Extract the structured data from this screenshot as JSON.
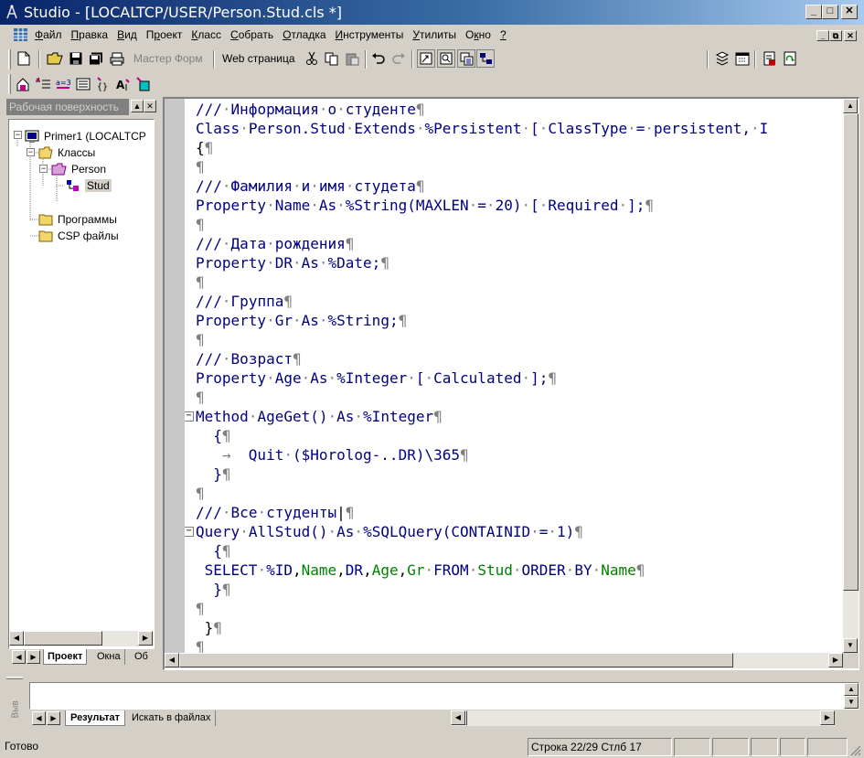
{
  "window": {
    "title": "Studio - [LOCALTCP/USER/Person.Stud.cls *]",
    "min_glyph": "_",
    "max_glyph": "□",
    "close_glyph": "✕"
  },
  "menu": {
    "items": [
      {
        "label": "Файл",
        "accel": "Ф",
        "rest": "айл"
      },
      {
        "label": "Правка",
        "accel": "П",
        "rest": "равка"
      },
      {
        "label": "Вид",
        "accel": "В",
        "rest": "ид"
      },
      {
        "label": "Проект",
        "accel": "р",
        "pre": "П",
        "rest": "оект"
      },
      {
        "label": "Класс",
        "accel": "К",
        "rest": "ласс"
      },
      {
        "label": "Собрать",
        "accel": "С",
        "rest": "обрать"
      },
      {
        "label": "Отладка",
        "accel": "О",
        "rest": "тладка"
      },
      {
        "label": "Инструменты",
        "accel": "И",
        "rest": "нструменты"
      },
      {
        "label": "Утилиты",
        "accel": "У",
        "rest": "тилиты"
      },
      {
        "label": "Окно",
        "accel": "к",
        "pre": "О",
        "rest": "но"
      },
      {
        "label": "?",
        "accel": "?",
        "rest": ""
      }
    ]
  },
  "toolbar": {
    "wizard_label": "Мастер Форм",
    "web_label": "Web страница",
    "combo_value": ""
  },
  "workspace": {
    "title": "Рабочая поверхность",
    "tree": {
      "root": "Primer1  (LOCALTCP",
      "classes": "Классы",
      "package": "Person",
      "class": "Stud",
      "programs": "Программы",
      "csp": "CSP файлы"
    },
    "tabs": [
      "Проект",
      "Окна",
      "Об"
    ]
  },
  "editor": {
    "lines": [
      [
        [
          "c",
          "///"
        ],
        [
          "p",
          "·"
        ],
        [
          "c",
          "Информация"
        ],
        [
          "p",
          "·"
        ],
        [
          "c",
          "о"
        ],
        [
          "p",
          "·"
        ],
        [
          "c",
          "студенте"
        ],
        [
          "p",
          "¶"
        ]
      ],
      [
        [
          "c",
          "Class"
        ],
        [
          "p",
          "·"
        ],
        [
          "c",
          "Person.Stud"
        ],
        [
          "p",
          "·"
        ],
        [
          "c",
          "Extends"
        ],
        [
          "p",
          "·"
        ],
        [
          "c",
          "%Persistent"
        ],
        [
          "p",
          "·"
        ],
        [
          "c",
          "["
        ],
        [
          "p",
          "·"
        ],
        [
          "c",
          "ClassType"
        ],
        [
          "p",
          "·"
        ],
        [
          "c",
          "="
        ],
        [
          "p",
          "·"
        ],
        [
          "c",
          "persistent,"
        ],
        [
          "p",
          "·"
        ],
        [
          "c",
          "I"
        ]
      ],
      [
        [
          "b",
          "{"
        ],
        [
          "p",
          "¶"
        ]
      ],
      [
        [
          "p",
          "¶"
        ]
      ],
      [
        [
          "c",
          "///"
        ],
        [
          "p",
          "·"
        ],
        [
          "c",
          "Фамилия"
        ],
        [
          "p",
          "·"
        ],
        [
          "c",
          "и"
        ],
        [
          "p",
          "·"
        ],
        [
          "c",
          "имя"
        ],
        [
          "p",
          "·"
        ],
        [
          "c",
          "студета"
        ],
        [
          "p",
          "¶"
        ]
      ],
      [
        [
          "c",
          "Property"
        ],
        [
          "p",
          "·"
        ],
        [
          "c",
          "Name"
        ],
        [
          "p",
          "·"
        ],
        [
          "c",
          "As"
        ],
        [
          "p",
          "·"
        ],
        [
          "c",
          "%String(MAXLEN"
        ],
        [
          "p",
          "·"
        ],
        [
          "c",
          "="
        ],
        [
          "p",
          "·"
        ],
        [
          "c",
          "20)"
        ],
        [
          "p",
          "·"
        ],
        [
          "c",
          "["
        ],
        [
          "p",
          "·"
        ],
        [
          "c",
          "Required"
        ],
        [
          "p",
          "·"
        ],
        [
          "c",
          "];"
        ],
        [
          "p",
          "¶"
        ]
      ],
      [
        [
          "p",
          "¶"
        ]
      ],
      [
        [
          "c",
          "///"
        ],
        [
          "p",
          "·"
        ],
        [
          "c",
          "Дата"
        ],
        [
          "p",
          "·"
        ],
        [
          "c",
          "рождения"
        ],
        [
          "p",
          "¶"
        ]
      ],
      [
        [
          "c",
          "Property"
        ],
        [
          "p",
          "·"
        ],
        [
          "c",
          "DR"
        ],
        [
          "p",
          "·"
        ],
        [
          "c",
          "As"
        ],
        [
          "p",
          "·"
        ],
        [
          "c",
          "%Date;"
        ],
        [
          "p",
          "¶"
        ]
      ],
      [
        [
          "p",
          "¶"
        ]
      ],
      [
        [
          "c",
          "///"
        ],
        [
          "p",
          "·"
        ],
        [
          "c",
          "Группа"
        ],
        [
          "p",
          "¶"
        ]
      ],
      [
        [
          "c",
          "Property"
        ],
        [
          "p",
          "·"
        ],
        [
          "c",
          "Gr"
        ],
        [
          "p",
          "·"
        ],
        [
          "c",
          "As"
        ],
        [
          "p",
          "·"
        ],
        [
          "c",
          "%String;"
        ],
        [
          "p",
          "¶"
        ]
      ],
      [
        [
          "p",
          "¶"
        ]
      ],
      [
        [
          "c",
          "///"
        ],
        [
          "p",
          "·"
        ],
        [
          "c",
          "Возраст"
        ],
        [
          "p",
          "¶"
        ]
      ],
      [
        [
          "c",
          "Property"
        ],
        [
          "p",
          "·"
        ],
        [
          "c",
          "Age"
        ],
        [
          "p",
          "·"
        ],
        [
          "c",
          "As"
        ],
        [
          "p",
          "·"
        ],
        [
          "c",
          "%Integer"
        ],
        [
          "p",
          "·"
        ],
        [
          "c",
          "["
        ],
        [
          "p",
          "·"
        ],
        [
          "c",
          "Calculated"
        ],
        [
          "p",
          "·"
        ],
        [
          "c",
          "];"
        ],
        [
          "p",
          "¶"
        ]
      ],
      [
        [
          "p",
          "¶"
        ]
      ],
      [
        [
          "c",
          "Method"
        ],
        [
          "p",
          "·"
        ],
        [
          "c",
          "AgeGet()"
        ],
        [
          "p",
          "·"
        ],
        [
          "c",
          "As"
        ],
        [
          "p",
          "·"
        ],
        [
          "c",
          "%Integer"
        ],
        [
          "p",
          "¶"
        ]
      ],
      [
        [
          "c",
          "  {"
        ],
        [
          "p",
          "¶"
        ]
      ],
      [
        [
          "p",
          "   →  "
        ],
        [
          "c",
          "Quit"
        ],
        [
          "p",
          "·"
        ],
        [
          "c",
          "($Horolog-..DR)\\365"
        ],
        [
          "p",
          "¶"
        ]
      ],
      [
        [
          "c",
          "  }"
        ],
        [
          "p",
          "¶"
        ]
      ],
      [
        [
          "p",
          "¶"
        ]
      ],
      [
        [
          "c",
          "///"
        ],
        [
          "p",
          "·"
        ],
        [
          "c",
          "Все"
        ],
        [
          "p",
          "·"
        ],
        [
          "c",
          "студенты"
        ],
        [
          "b",
          "|"
        ],
        [
          "p",
          "¶"
        ]
      ],
      [
        [
          "c",
          "Query"
        ],
        [
          "p",
          "·"
        ],
        [
          "c",
          "AllStud()"
        ],
        [
          "p",
          "·"
        ],
        [
          "c",
          "As"
        ],
        [
          "p",
          "·"
        ],
        [
          "c",
          "%SQLQuery(CONTAINID"
        ],
        [
          "p",
          "·"
        ],
        [
          "c",
          "="
        ],
        [
          "p",
          "·"
        ],
        [
          "c",
          "1)"
        ],
        [
          "p",
          "¶"
        ]
      ],
      [
        [
          "c",
          "  {"
        ],
        [
          "p",
          "¶"
        ]
      ],
      [
        [
          "c",
          " SELECT"
        ],
        [
          "p",
          "·"
        ],
        [
          "c",
          "%ID"
        ],
        [
          "b",
          ","
        ],
        [
          "g",
          "Name"
        ],
        [
          "b",
          ","
        ],
        [
          "c",
          "DR"
        ],
        [
          "b",
          ","
        ],
        [
          "g",
          "Age"
        ],
        [
          "b",
          ","
        ],
        [
          "g",
          "Gr"
        ],
        [
          "p",
          "·"
        ],
        [
          "c",
          "FROM"
        ],
        [
          "p",
          "·"
        ],
        [
          "g",
          "Stud"
        ],
        [
          "p",
          "·"
        ],
        [
          "c",
          "ORDER"
        ],
        [
          "p",
          "·"
        ],
        [
          "c",
          "BY"
        ],
        [
          "p",
          "·"
        ],
        [
          "g",
          "Name"
        ],
        [
          "p",
          "¶"
        ]
      ],
      [
        [
          "c",
          "  }"
        ],
        [
          "p",
          "¶"
        ]
      ],
      [
        [
          "p",
          "¶"
        ]
      ],
      [
        [
          "b",
          " }"
        ],
        [
          "p",
          "¶"
        ]
      ],
      [
        [
          "p",
          "¶"
        ]
      ]
    ],
    "fold_marks": [
      "⊟",
      "⊟"
    ]
  },
  "output": {
    "side_label": "Выв",
    "tabs": [
      "Результат",
      "Искать в файлах"
    ]
  },
  "status": {
    "ready": "Готово",
    "position": "Строка 22/29 Стлб 17"
  }
}
